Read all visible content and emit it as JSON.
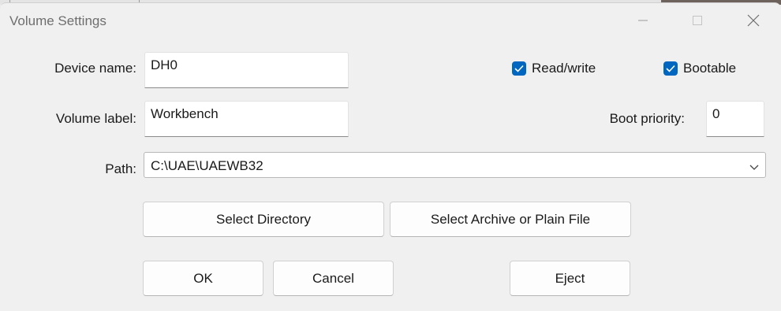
{
  "window": {
    "title": "Volume Settings"
  },
  "fields": {
    "device_name_label": "Device name:",
    "device_name_value": "DH0",
    "volume_label_label": "Volume label:",
    "volume_label_value": "Workbench",
    "boot_priority_label": "Boot priority:",
    "boot_priority_value": "0",
    "path_label": "Path:",
    "path_value": "C:\\UAE\\UAEWB32"
  },
  "checkboxes": {
    "read_write": {
      "label": "Read/write",
      "checked": true
    },
    "bootable": {
      "label": "Bootable",
      "checked": true
    }
  },
  "buttons": {
    "select_directory": "Select Directory",
    "select_archive": "Select Archive or Plain File",
    "ok": "OK",
    "cancel": "Cancel",
    "eject": "Eject"
  },
  "colors": {
    "accent": "#0067c0",
    "background": "#f0f0f0"
  },
  "icons": {
    "minimize": "minimize-icon",
    "maximize": "maximize-icon",
    "close": "close-icon",
    "check": "checkmark-icon",
    "dropdown": "chevron-down-icon"
  }
}
